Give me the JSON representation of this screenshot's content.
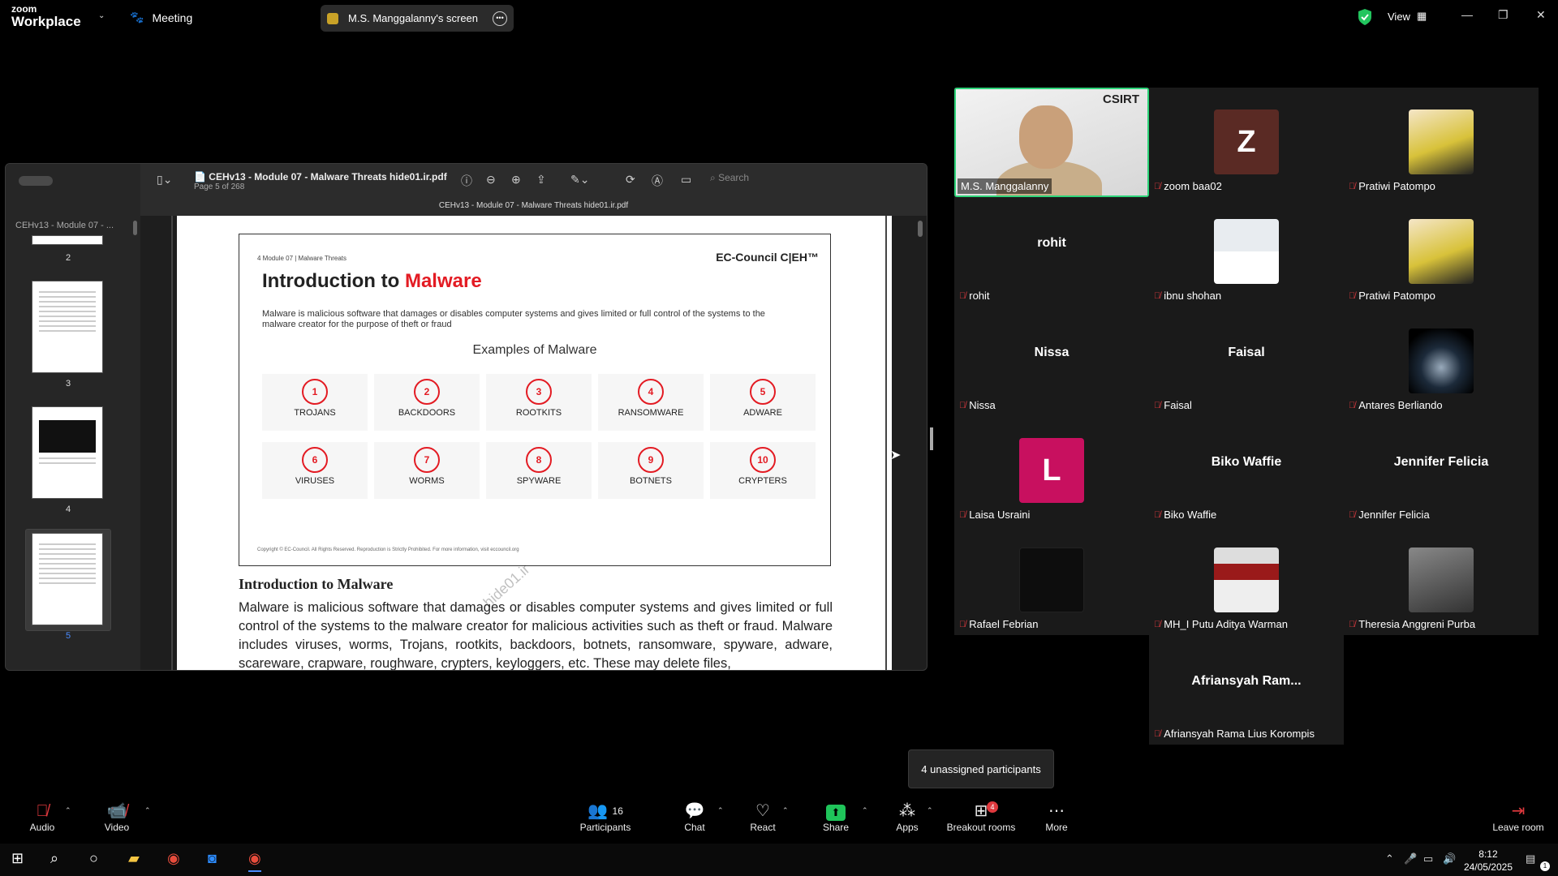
{
  "app": {
    "logo_line1": "zoom",
    "logo_line2": "Workplace",
    "meeting_label": "Meeting",
    "shared_by": "M.S. Manggalanny's screen",
    "view_label": "View"
  },
  "viewer": {
    "doc_title": "CEHv13 - Module 07 - Malware Threats hide01.ir.pdf",
    "page_indicator": "Page 5 of 268",
    "subtitle": "CEHv13 - Module 07 - Malware Threats hide01.ir.pdf",
    "sidebar_title": "CEHv13 - Module 07 - ...",
    "search_placeholder": "Search",
    "thumbnails": [
      "2",
      "3",
      "4",
      "5"
    ]
  },
  "slide": {
    "module": "4     Module 07 | Malware Threats",
    "brand": "EC-Council  C|EH™",
    "title_a": "Introduction to ",
    "title_b": "Malware",
    "desc": "Malware is malicious software that damages or disables computer systems and gives limited or full control of the systems to the malware creator for the purpose of theft or fraud",
    "examples_heading": "Examples of Malware",
    "items": [
      {
        "n": "1",
        "label": "TROJANS"
      },
      {
        "n": "2",
        "label": "BACKDOORS"
      },
      {
        "n": "3",
        "label": "ROOTKITS"
      },
      {
        "n": "4",
        "label": "RANSOMWARE"
      },
      {
        "n": "5",
        "label": "ADWARE"
      },
      {
        "n": "6",
        "label": "VIRUSES"
      },
      {
        "n": "7",
        "label": "WORMS"
      },
      {
        "n": "8",
        "label": "SPYWARE"
      },
      {
        "n": "9",
        "label": "BOTNETS"
      },
      {
        "n": "10",
        "label": "CRYPTERS"
      }
    ],
    "copyright": "Copyright © EC-Council. All Rights Reserved. Reproduction is Strictly Prohibited. For more information, visit eccouncil.org"
  },
  "page_text": {
    "heading": "Introduction to Malware",
    "body": "Malware is malicious software that damages or disables computer systems and gives limited or full control of the systems to the malware creator for malicious activities such as theft or fraud. Malware includes viruses, worms, Trojans, rootkits, backdoors, botnets, ransomware, spyware, adware, scareware, crapware, roughware, crypters, keyloggers, etc. These may delete files,",
    "watermark": "hide01.ir"
  },
  "participants": [
    {
      "name": "M.S. Manggalanny",
      "type": "video",
      "active": true,
      "overlay": "CSIRT"
    },
    {
      "name": "zoom baa02",
      "type": "initial",
      "initial": "Z",
      "color": "#5a2a24"
    },
    {
      "name": "Pratiwi Patompo",
      "type": "photo",
      "color": "#d8c23a"
    },
    {
      "name": "rohit",
      "type": "name",
      "display": "rohit"
    },
    {
      "name": "ibnu shohan",
      "type": "photo",
      "color": "#e8ecf0"
    },
    {
      "name": "Pratiwi Patompo",
      "type": "photo",
      "color": "#d8c23a"
    },
    {
      "name": "Nissa",
      "type": "name",
      "display": "Nissa"
    },
    {
      "name": "Faisal",
      "type": "name",
      "display": "Faisal"
    },
    {
      "name": "Antares Berliando",
      "type": "photo",
      "color": "#1c2a3a"
    },
    {
      "name": "Laisa Usraini",
      "type": "initial",
      "initial": "L",
      "color": "#c8105f"
    },
    {
      "name": "Biko Waffie",
      "type": "name",
      "display": "Biko Waffie"
    },
    {
      "name": "Jennifer Felicia",
      "type": "name",
      "display": "Jennifer Felicia"
    },
    {
      "name": "Rafael Febrian",
      "type": "photo",
      "color": "#0d0d0d"
    },
    {
      "name": "MH_I Putu Aditya Warman",
      "type": "photo",
      "color": "#9a1a1a"
    },
    {
      "name": "Theresia Anggreni Purba",
      "type": "photo",
      "color": "#555555"
    },
    {
      "name": "Afriansyah Rama Lius Korompis",
      "type": "name",
      "display": "Afriansyah  Ram..."
    }
  ],
  "unassigned": "4 unassigned participants",
  "controls": {
    "audio": "Audio",
    "video": "Video",
    "participants": "Participants",
    "participants_count": "16",
    "chat": "Chat",
    "react": "React",
    "share": "Share",
    "apps": "Apps",
    "breakout": "Breakout rooms",
    "breakout_badge": "4",
    "more": "More",
    "leave": "Leave room"
  },
  "taskbar": {
    "time": "8:12",
    "date": "24/05/2025",
    "notif": "1"
  },
  "colors": {
    "accent_green": "#2ed47a",
    "mute_red": "#e0393e",
    "malware_red": "#e31b23"
  }
}
